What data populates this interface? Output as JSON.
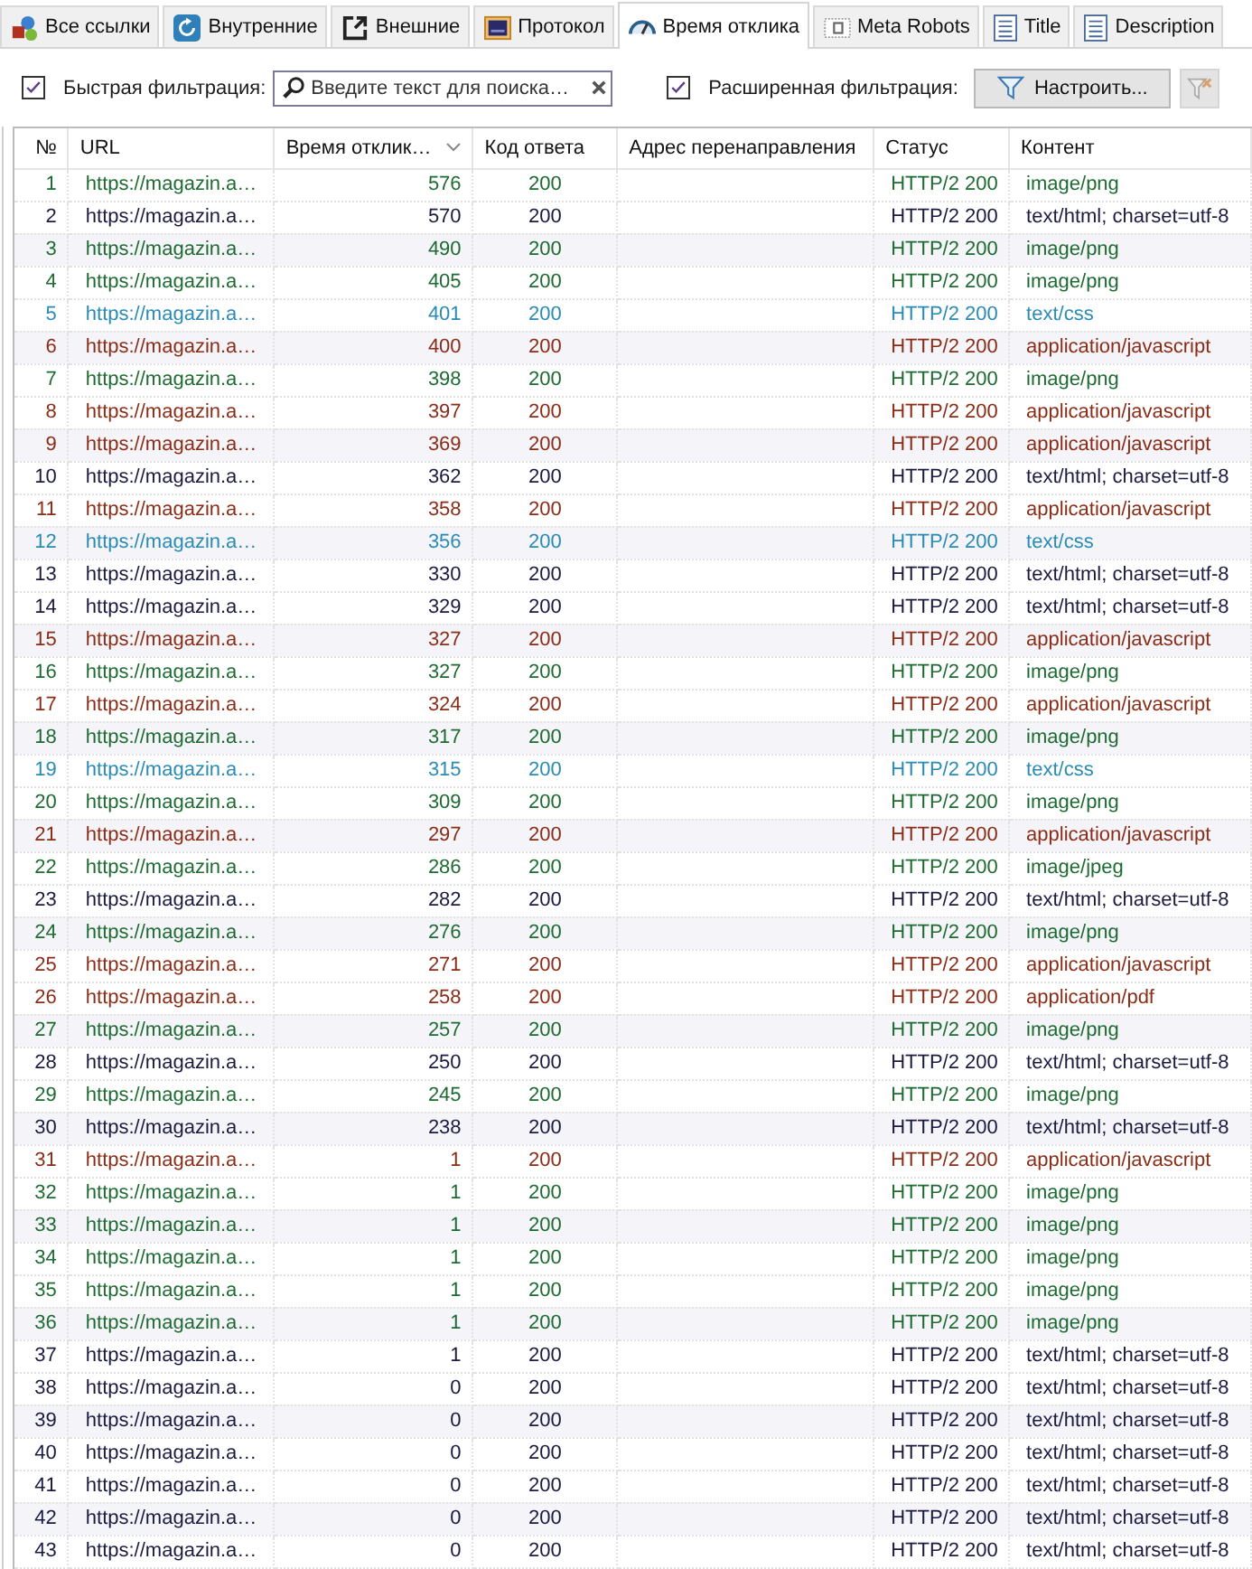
{
  "tabs": [
    {
      "label": "Все ссылки",
      "selected": false
    },
    {
      "label": "Внутренние",
      "selected": false
    },
    {
      "label": "Внешние",
      "selected": false
    },
    {
      "label": "Протокол",
      "selected": false
    },
    {
      "label": "Время отклика",
      "selected": true
    },
    {
      "label": "Meta Robots",
      "selected": false
    },
    {
      "label": "Title",
      "selected": false
    },
    {
      "label": "Description",
      "selected": false
    }
  ],
  "filter_bar": {
    "quick_filter": {
      "label": "Быстрая фильтрация:",
      "checked": true,
      "placeholder": "Введите текст для поиска…"
    },
    "advanced_filter": {
      "label": "Расширенная фильтрация:",
      "checked": true,
      "button": "Настроить..."
    },
    "reset_button": {
      "disabled": true
    }
  },
  "table": {
    "columns": [
      {
        "label": "№",
        "sorted": false
      },
      {
        "label": "URL",
        "sorted": false
      },
      {
        "label": "Время отклик…",
        "sorted": true
      },
      {
        "label": "Код ответа",
        "sorted": false
      },
      {
        "label": "Адрес перенаправления",
        "sorted": false
      },
      {
        "label": "Статус",
        "sorted": false
      },
      {
        "label": "Контент",
        "sorted": false
      }
    ],
    "rows": [
      {
        "number": "1",
        "url": "https://magazin.a…",
        "response_time": "576",
        "code": "200",
        "status": "HTTP/2 200",
        "content": "image/png",
        "color": "#1e6b32"
      },
      {
        "number": "2",
        "url": "https://magazin.a…",
        "response_time": "570",
        "code": "200",
        "status": "HTTP/2 200",
        "content": "text/html; charset=utf-8",
        "color": "#1a1a40"
      },
      {
        "number": "3",
        "url": "https://magazin.a…",
        "response_time": "490",
        "code": "200",
        "status": "HTTP/2 200",
        "content": "image/png",
        "color": "#1e6b32"
      },
      {
        "number": "4",
        "url": "https://magazin.a…",
        "response_time": "405",
        "code": "200",
        "status": "HTTP/2 200",
        "content": "image/png",
        "color": "#1e6b32"
      },
      {
        "number": "5",
        "url": "https://magazin.a…",
        "response_time": "401",
        "code": "200",
        "status": "HTTP/2 200",
        "content": "text/css",
        "color": "#2a8bb5"
      },
      {
        "number": "6",
        "url": "https://magazin.a…",
        "response_time": "400",
        "code": "200",
        "status": "HTTP/2 200",
        "content": "application/javascript",
        "color": "#8b2c16"
      },
      {
        "number": "7",
        "url": "https://magazin.a…",
        "response_time": "398",
        "code": "200",
        "status": "HTTP/2 200",
        "content": "image/png",
        "color": "#1e6b32"
      },
      {
        "number": "8",
        "url": "https://magazin.a…",
        "response_time": "397",
        "code": "200",
        "status": "HTTP/2 200",
        "content": "application/javascript",
        "color": "#8b2c16"
      },
      {
        "number": "9",
        "url": "https://magazin.a…",
        "response_time": "369",
        "code": "200",
        "status": "HTTP/2 200",
        "content": "application/javascript",
        "color": "#8b2c16"
      },
      {
        "number": "10",
        "url": "https://magazin.a…",
        "response_time": "362",
        "code": "200",
        "status": "HTTP/2 200",
        "content": "text/html; charset=utf-8",
        "color": "#1a1a40"
      },
      {
        "number": "11",
        "url": "https://magazin.a…",
        "response_time": "358",
        "code": "200",
        "status": "HTTP/2 200",
        "content": "application/javascript",
        "color": "#8b2c16"
      },
      {
        "number": "12",
        "url": "https://magazin.a…",
        "response_time": "356",
        "code": "200",
        "status": "HTTP/2 200",
        "content": "text/css",
        "color": "#2a8bb5"
      },
      {
        "number": "13",
        "url": "https://magazin.a…",
        "response_time": "330",
        "code": "200",
        "status": "HTTP/2 200",
        "content": "text/html; charset=utf-8",
        "color": "#1a1a40"
      },
      {
        "number": "14",
        "url": "https://magazin.a…",
        "response_time": "329",
        "code": "200",
        "status": "HTTP/2 200",
        "content": "text/html; charset=utf-8",
        "color": "#1a1a40"
      },
      {
        "number": "15",
        "url": "https://magazin.a…",
        "response_time": "327",
        "code": "200",
        "status": "HTTP/2 200",
        "content": "application/javascript",
        "color": "#8b2c16"
      },
      {
        "number": "16",
        "url": "https://magazin.a…",
        "response_time": "327",
        "code": "200",
        "status": "HTTP/2 200",
        "content": "image/png",
        "color": "#1e6b32"
      },
      {
        "number": "17",
        "url": "https://magazin.a…",
        "response_time": "324",
        "code": "200",
        "status": "HTTP/2 200",
        "content": "application/javascript",
        "color": "#8b2c16"
      },
      {
        "number": "18",
        "url": "https://magazin.a…",
        "response_time": "317",
        "code": "200",
        "status": "HTTP/2 200",
        "content": "image/png",
        "color": "#1e6b32"
      },
      {
        "number": "19",
        "url": "https://magazin.a…",
        "response_time": "315",
        "code": "200",
        "status": "HTTP/2 200",
        "content": "text/css",
        "color": "#2a8bb5"
      },
      {
        "number": "20",
        "url": "https://magazin.a…",
        "response_time": "309",
        "code": "200",
        "status": "HTTP/2 200",
        "content": "image/png",
        "color": "#1e6b32"
      },
      {
        "number": "21",
        "url": "https://magazin.a…",
        "response_time": "297",
        "code": "200",
        "status": "HTTP/2 200",
        "content": "application/javascript",
        "color": "#8b2c16"
      },
      {
        "number": "22",
        "url": "https://magazin.a…",
        "response_time": "286",
        "code": "200",
        "status": "HTTP/2 200",
        "content": "image/jpeg",
        "color": "#1e6b32"
      },
      {
        "number": "23",
        "url": "https://magazin.a…",
        "response_time": "282",
        "code": "200",
        "status": "HTTP/2 200",
        "content": "text/html; charset=utf-8",
        "color": "#1a1a40"
      },
      {
        "number": "24",
        "url": "https://magazin.a…",
        "response_time": "276",
        "code": "200",
        "status": "HTTP/2 200",
        "content": "image/png",
        "color": "#1e6b32"
      },
      {
        "number": "25",
        "url": "https://magazin.a…",
        "response_time": "271",
        "code": "200",
        "status": "HTTP/2 200",
        "content": "application/javascript",
        "color": "#8b2c16"
      },
      {
        "number": "26",
        "url": "https://magazin.a…",
        "response_time": "258",
        "code": "200",
        "status": "HTTP/2 200",
        "content": "application/pdf",
        "color": "#8b2c16"
      },
      {
        "number": "27",
        "url": "https://magazin.a…",
        "response_time": "257",
        "code": "200",
        "status": "HTTP/2 200",
        "content": "image/png",
        "color": "#1e6b32"
      },
      {
        "number": "28",
        "url": "https://magazin.a…",
        "response_time": "250",
        "code": "200",
        "status": "HTTP/2 200",
        "content": "text/html; charset=utf-8",
        "color": "#1a1a40"
      },
      {
        "number": "29",
        "url": "https://magazin.a…",
        "response_time": "245",
        "code": "200",
        "status": "HTTP/2 200",
        "content": "image/png",
        "color": "#1e6b32"
      },
      {
        "number": "30",
        "url": "https://magazin.a…",
        "response_time": "238",
        "code": "200",
        "status": "HTTP/2 200",
        "content": "text/html; charset=utf-8",
        "color": "#1a1a40"
      },
      {
        "number": "31",
        "url": "https://magazin.a…",
        "response_time": "1",
        "code": "200",
        "status": "HTTP/2 200",
        "content": "application/javascript",
        "color": "#8b2c16"
      },
      {
        "number": "32",
        "url": "https://magazin.a…",
        "response_time": "1",
        "code": "200",
        "status": "HTTP/2 200",
        "content": "image/png",
        "color": "#1e6b32"
      },
      {
        "number": "33",
        "url": "https://magazin.a…",
        "response_time": "1",
        "code": "200",
        "status": "HTTP/2 200",
        "content": "image/png",
        "color": "#1e6b32"
      },
      {
        "number": "34",
        "url": "https://magazin.a…",
        "response_time": "1",
        "code": "200",
        "status": "HTTP/2 200",
        "content": "image/png",
        "color": "#1e6b32"
      },
      {
        "number": "35",
        "url": "https://magazin.a…",
        "response_time": "1",
        "code": "200",
        "status": "HTTP/2 200",
        "content": "image/png",
        "color": "#1e6b32"
      },
      {
        "number": "36",
        "url": "https://magazin.a…",
        "response_time": "1",
        "code": "200",
        "status": "HTTP/2 200",
        "content": "image/png",
        "color": "#1e6b32"
      },
      {
        "number": "37",
        "url": "https://magazin.a…",
        "response_time": "1",
        "code": "200",
        "status": "HTTP/2 200",
        "content": "text/html; charset=utf-8",
        "color": "#1a1a40"
      },
      {
        "number": "38",
        "url": "https://magazin.a…",
        "response_time": "0",
        "code": "200",
        "status": "HTTP/2 200",
        "content": "text/html; charset=utf-8",
        "color": "#1a1a40"
      },
      {
        "number": "39",
        "url": "https://magazin.a…",
        "response_time": "0",
        "code": "200",
        "status": "HTTP/2 200",
        "content": "text/html; charset=utf-8",
        "color": "#1a1a40"
      },
      {
        "number": "40",
        "url": "https://magazin.a…",
        "response_time": "0",
        "code": "200",
        "status": "HTTP/2 200",
        "content": "text/html; charset=utf-8",
        "color": "#1a1a40"
      },
      {
        "number": "41",
        "url": "https://magazin.a…",
        "response_time": "0",
        "code": "200",
        "status": "HTTP/2 200",
        "content": "text/html; charset=utf-8",
        "color": "#1a1a40"
      },
      {
        "number": "42",
        "url": "https://magazin.a…",
        "response_time": "0",
        "code": "200",
        "status": "HTTP/2 200",
        "content": "text/html; charset=utf-8",
        "color": "#1a1a40"
      },
      {
        "number": "43",
        "url": "https://magazin.a…",
        "response_time": "0",
        "code": "200",
        "status": "HTTP/2 200",
        "content": "text/html; charset=utf-8",
        "color": "#1a1a40"
      }
    ]
  }
}
